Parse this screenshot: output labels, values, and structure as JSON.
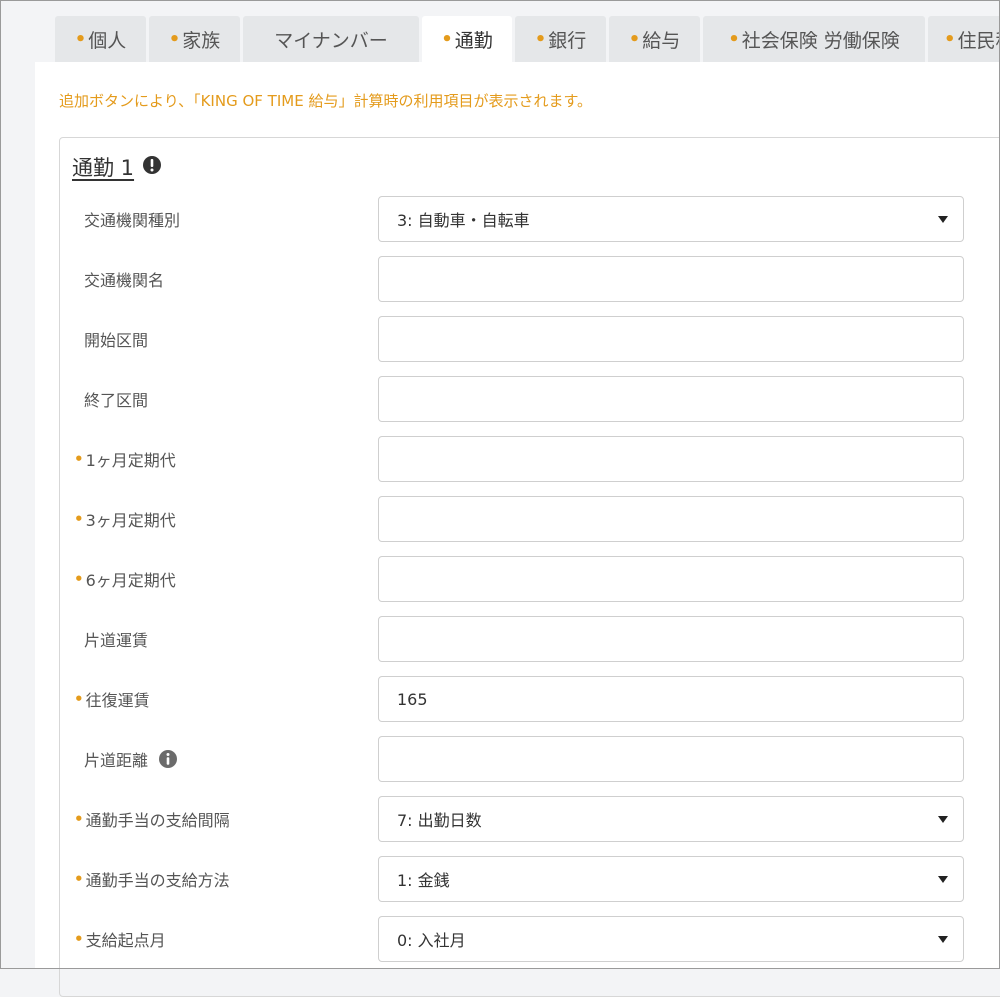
{
  "tabs": [
    {
      "label": "個人",
      "required": true
    },
    {
      "label": "家族",
      "required": true
    },
    {
      "label": "マイナンバー",
      "required": false
    },
    {
      "label": "通勤",
      "required": true,
      "active": true
    },
    {
      "label": "銀行",
      "required": true
    },
    {
      "label": "給与",
      "required": true
    },
    {
      "label": "社会保険 労働保険",
      "required": true
    },
    {
      "label": "住民税",
      "required": true
    }
  ],
  "notice": "追加ボタンにより、「KING OF TIME 給与」計算時の利用項目が表示されます。",
  "section": {
    "title": "通勤 1",
    "alert_icon": "exclamation-circle-icon"
  },
  "fields": [
    {
      "label": "交通機関種別",
      "required": false,
      "type": "select",
      "value": "3: 自動車・自転車"
    },
    {
      "label": "交通機関名",
      "required": false,
      "type": "text",
      "value": ""
    },
    {
      "label": "開始区間",
      "required": false,
      "type": "text",
      "value": ""
    },
    {
      "label": "終了区間",
      "required": false,
      "type": "text",
      "value": ""
    },
    {
      "label": "1ヶ月定期代",
      "required": true,
      "type": "text",
      "value": ""
    },
    {
      "label": "3ヶ月定期代",
      "required": true,
      "type": "text",
      "value": ""
    },
    {
      "label": "6ヶ月定期代",
      "required": true,
      "type": "text",
      "value": ""
    },
    {
      "label": "片道運賃",
      "required": false,
      "type": "text",
      "value": ""
    },
    {
      "label": "往復運賃",
      "required": true,
      "type": "text",
      "value": "165"
    },
    {
      "label": "片道距離",
      "required": false,
      "type": "text",
      "value": "",
      "info_icon": "info-circle-icon"
    },
    {
      "label": "通勤手当の支給間隔",
      "required": true,
      "type": "select",
      "value": "7: 出勤日数"
    },
    {
      "label": "通勤手当の支給方法",
      "required": true,
      "type": "select",
      "value": "1: 金銭"
    },
    {
      "label": "支給起点月",
      "required": true,
      "type": "select",
      "value": "0: 入社月"
    }
  ],
  "colors": {
    "accent": "#e49b1c",
    "tab_bg": "#e5e7e9",
    "page_bg": "#f3f4f6",
    "border": "#cfcfcf"
  }
}
